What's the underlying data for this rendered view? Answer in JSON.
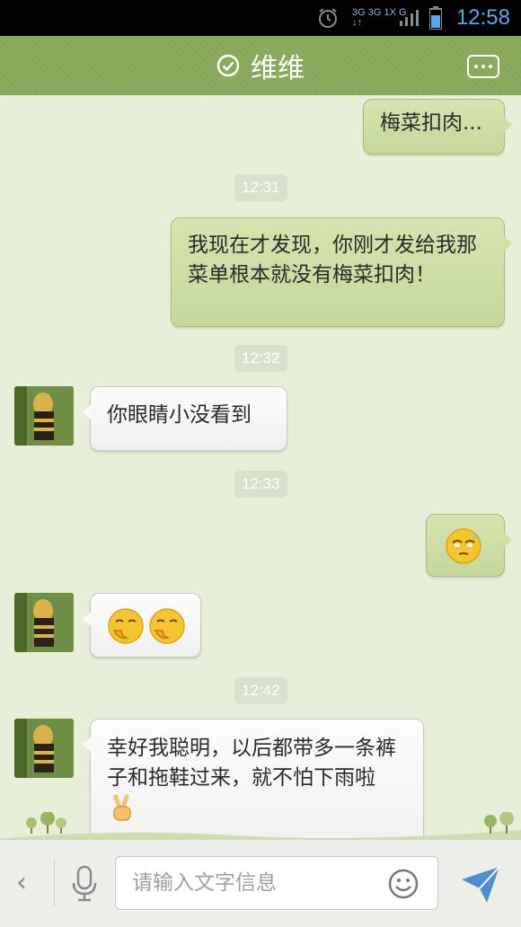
{
  "statusbar": {
    "time": "12:58",
    "net_top": "3G 3G 1X G",
    "net_bottom": "↓↑"
  },
  "header": {
    "title": "维维"
  },
  "messages": [
    {
      "dir": "out",
      "text": "梅菜扣肉..."
    },
    {
      "time": "12:31"
    },
    {
      "dir": "out",
      "text": "我现在才发现，你刚才发给我那菜单根本就没有梅菜扣肉！"
    },
    {
      "time": "12:32"
    },
    {
      "dir": "in",
      "text": "你眼睛小没看到"
    },
    {
      "time": "12:33"
    },
    {
      "dir": "out",
      "emoji": "sweat-smile-emoji"
    },
    {
      "dir": "in",
      "emoji": "giggle-emoji x2"
    },
    {
      "time": "12:42"
    },
    {
      "dir": "in",
      "text": "幸好我聪明，以后都带多一条裤子和拖鞋过来，就不怕下雨啦",
      "emoji": "victory-hand-emoji"
    }
  ],
  "input": {
    "placeholder": "请输入文字信息"
  },
  "colors": {
    "header": "#87a85a",
    "bubble_out": "#cddfa4",
    "background": "#e8efd9",
    "accent": "#5aa7e8"
  }
}
